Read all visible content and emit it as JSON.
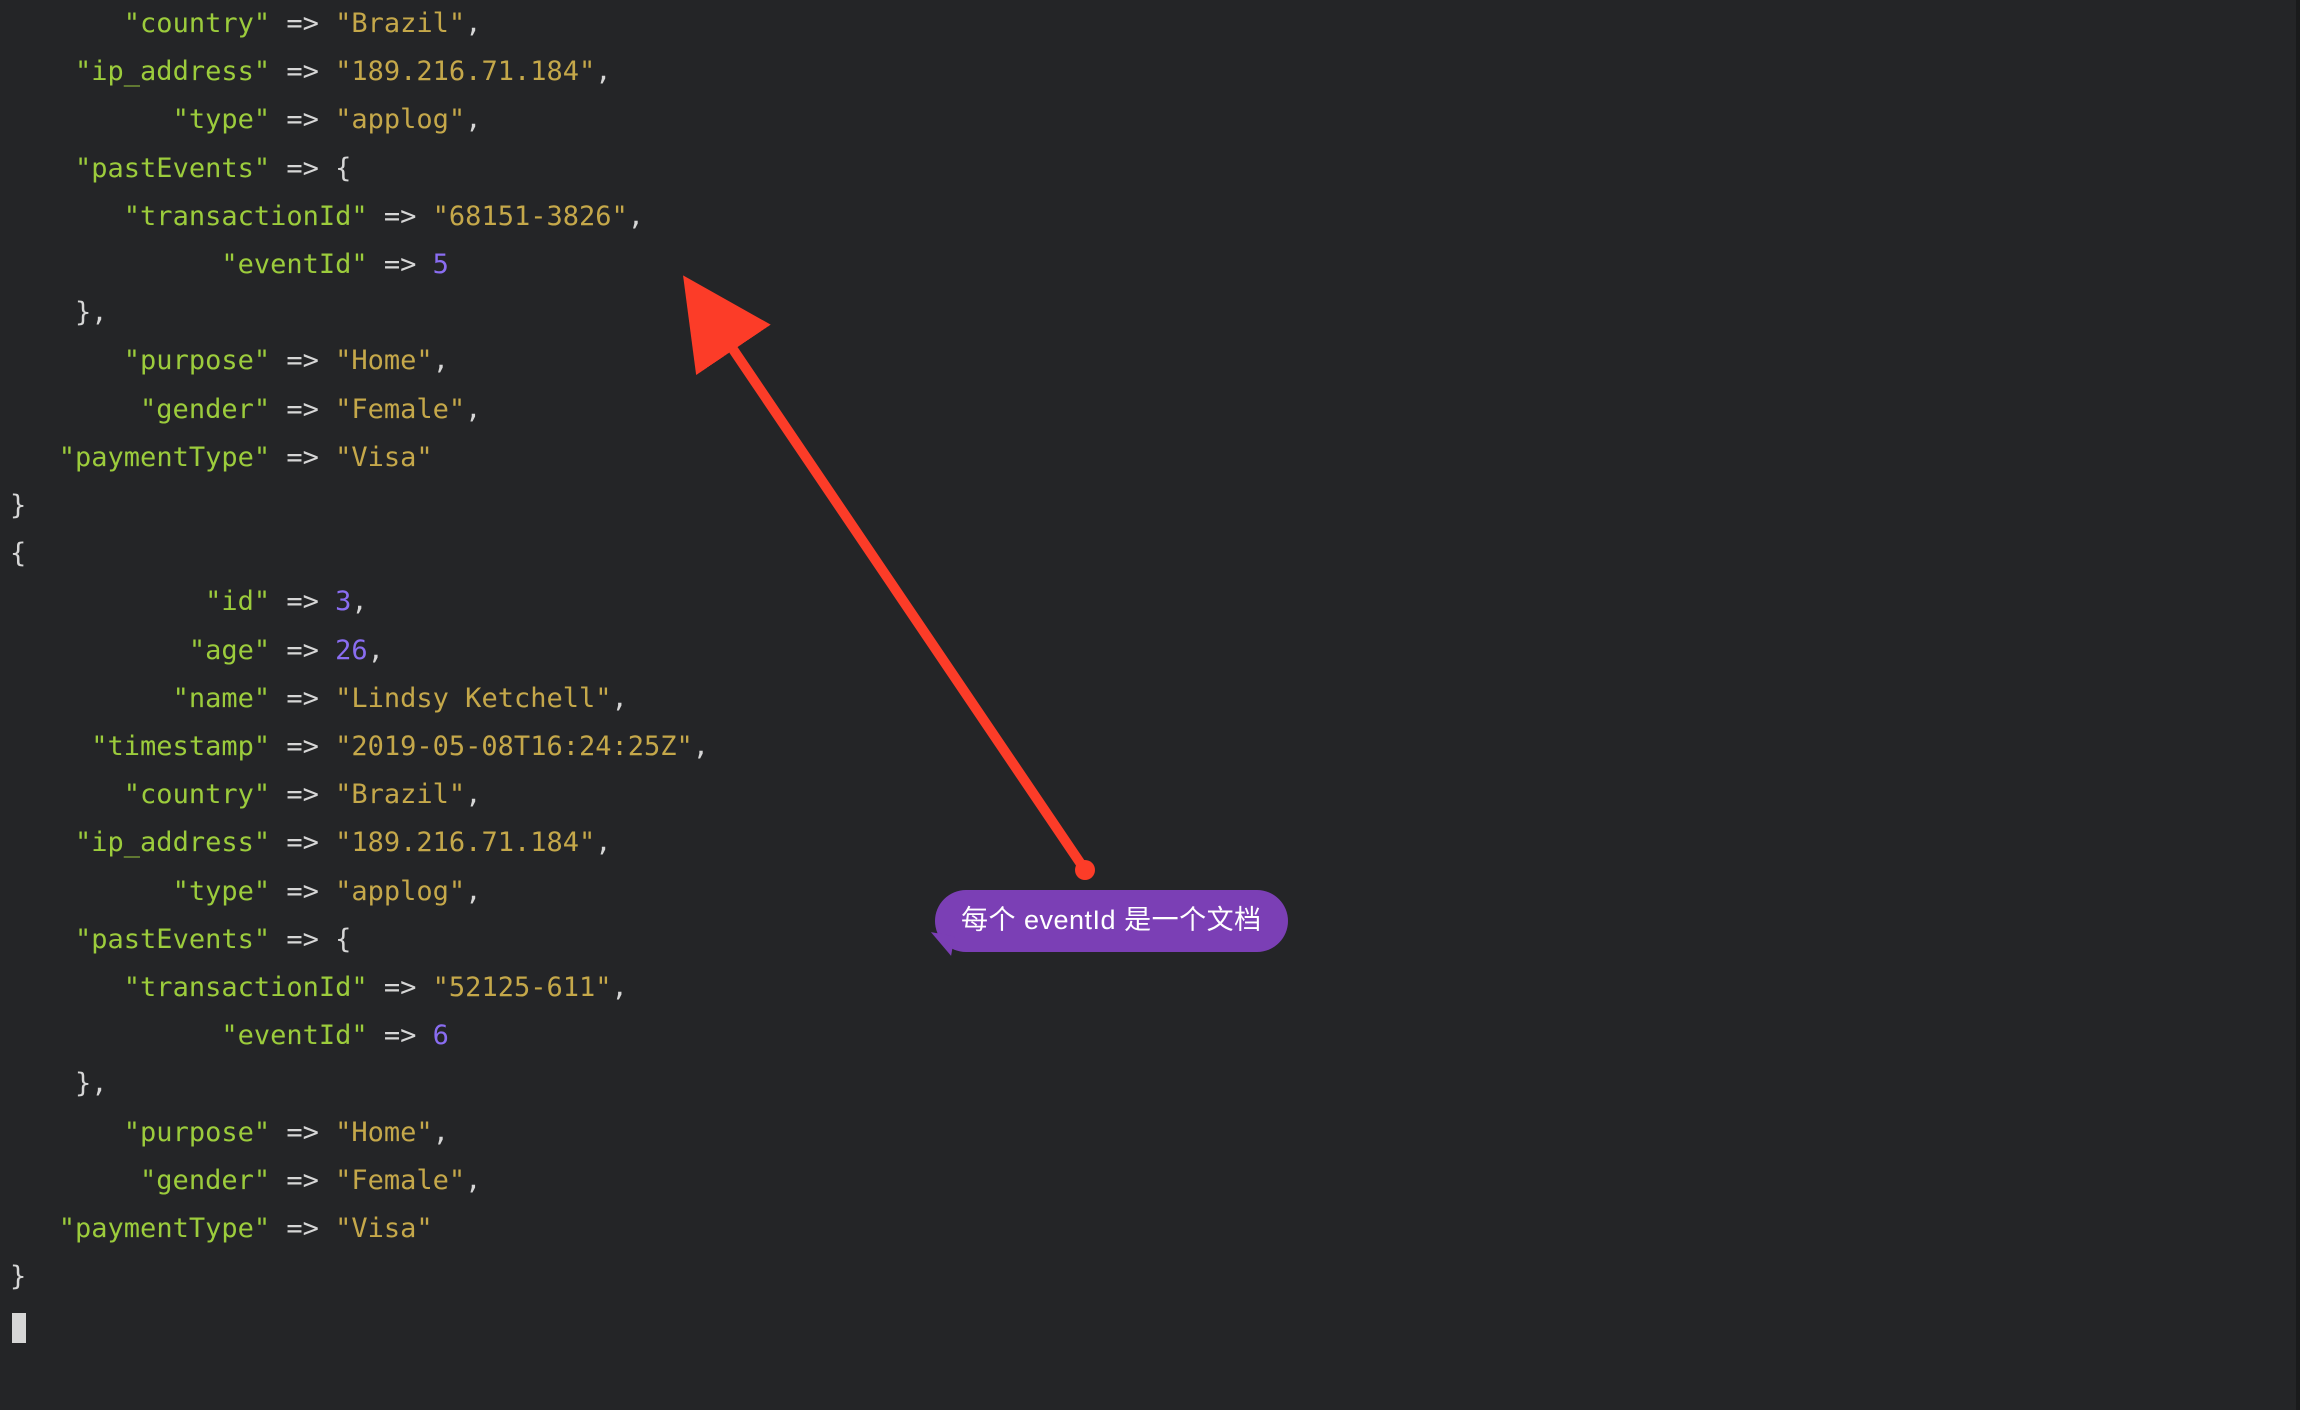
{
  "colors": {
    "bg": "#242527",
    "key": "#9ccc3c",
    "string": "#c5a84a",
    "number": "#8a6df2",
    "callout_bg": "#7b3fb5",
    "arrow": "#fc3c28"
  },
  "callout_text": "每个 eventId 是一个文档",
  "records": [
    {
      "partial_leading": true,
      "country": "Brazil",
      "ip_address": "189.216.71.184",
      "type": "applog",
      "pastEvents": {
        "transactionId": "68151-3826",
        "eventId": 5
      },
      "purpose": "Home",
      "gender": "Female",
      "paymentType": "Visa"
    },
    {
      "id": 3,
      "age": 26,
      "name": "Lindsy Ketchell",
      "timestamp": "2019-05-08T16:24:25Z",
      "country": "Brazil",
      "ip_address": "189.216.71.184",
      "type": "applog",
      "pastEvents": {
        "transactionId": "52125-611",
        "eventId": 6
      },
      "purpose": "Home",
      "gender": "Female",
      "paymentType": "Visa"
    }
  ],
  "code_lines": [
    {
      "indent": 7,
      "key": "country",
      "arrow": true,
      "value": "Brazil",
      "vtype": "string",
      "trail": ","
    },
    {
      "indent": 4,
      "key": "ip_address",
      "arrow": true,
      "value": "189.216.71.184",
      "vtype": "string",
      "trail": ","
    },
    {
      "indent": 10,
      "key": "type",
      "arrow": true,
      "value": "applog",
      "vtype": "string",
      "trail": ","
    },
    {
      "indent": 4,
      "key": "pastEvents",
      "arrow": true,
      "raw_after": "{",
      "vtype": "raw"
    },
    {
      "indent": 7,
      "key": "transactionId",
      "arrow": true,
      "value": "68151-3826",
      "vtype": "string",
      "trail": ","
    },
    {
      "indent": 13,
      "key": "eventId",
      "arrow": true,
      "value": "5",
      "vtype": "number"
    },
    {
      "indent": 4,
      "raw_before": "},",
      "vtype": "punct"
    },
    {
      "indent": 7,
      "key": "purpose",
      "arrow": true,
      "value": "Home",
      "vtype": "string",
      "trail": ","
    },
    {
      "indent": 8,
      "key": "gender",
      "arrow": true,
      "value": "Female",
      "vtype": "string",
      "trail": ","
    },
    {
      "indent": 3,
      "key": "paymentType",
      "arrow": true,
      "value": "Visa",
      "vtype": "string"
    },
    {
      "indent": 0,
      "raw_before": "}",
      "vtype": "punct"
    },
    {
      "indent": 0,
      "raw_before": "{",
      "vtype": "punct"
    },
    {
      "indent": 12,
      "key": "id",
      "arrow": true,
      "value": "3",
      "vtype": "number",
      "trail": ","
    },
    {
      "indent": 11,
      "key": "age",
      "arrow": true,
      "value": "26",
      "vtype": "number",
      "trail": ","
    },
    {
      "indent": 10,
      "key": "name",
      "arrow": true,
      "value": "Lindsy Ketchell",
      "vtype": "string",
      "trail": ","
    },
    {
      "indent": 5,
      "key": "timestamp",
      "arrow": true,
      "value": "2019-05-08T16:24:25Z",
      "vtype": "string",
      "trail": ","
    },
    {
      "indent": 7,
      "key": "country",
      "arrow": true,
      "value": "Brazil",
      "vtype": "string",
      "trail": ","
    },
    {
      "indent": 4,
      "key": "ip_address",
      "arrow": true,
      "value": "189.216.71.184",
      "vtype": "string",
      "trail": ","
    },
    {
      "indent": 10,
      "key": "type",
      "arrow": true,
      "value": "applog",
      "vtype": "string",
      "trail": ","
    },
    {
      "indent": 4,
      "key": "pastEvents",
      "arrow": true,
      "raw_after": "{",
      "vtype": "raw"
    },
    {
      "indent": 7,
      "key": "transactionId",
      "arrow": true,
      "value": "52125-611",
      "vtype": "string",
      "trail": ","
    },
    {
      "indent": 13,
      "key": "eventId",
      "arrow": true,
      "value": "6",
      "vtype": "number"
    },
    {
      "indent": 4,
      "raw_before": "},",
      "vtype": "punct"
    },
    {
      "indent": 7,
      "key": "purpose",
      "arrow": true,
      "value": "Home",
      "vtype": "string",
      "trail": ","
    },
    {
      "indent": 8,
      "key": "gender",
      "arrow": true,
      "value": "Female",
      "vtype": "string",
      "trail": ","
    },
    {
      "indent": 3,
      "key": "paymentType",
      "arrow": true,
      "value": "Visa",
      "vtype": "string"
    },
    {
      "indent": 0,
      "raw_before": "}",
      "vtype": "punct"
    }
  ]
}
